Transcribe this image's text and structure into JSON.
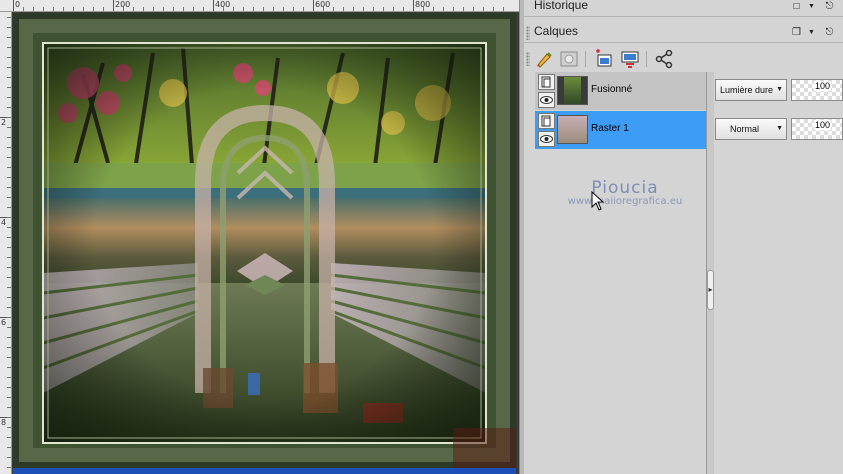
{
  "rulers": {
    "top_labels": [
      "0",
      "200",
      "400",
      "600",
      "800"
    ],
    "left_labels": [
      "2",
      "4",
      "6",
      "8"
    ]
  },
  "panels": {
    "history": {
      "title": "Historique"
    },
    "layers": {
      "title": "Calques",
      "toolbar": [
        {
          "icon": "paint-brush-icon"
        },
        {
          "icon": "mask-icon"
        },
        {
          "icon": "new-layer-icon"
        },
        {
          "icon": "layer-effects-icon"
        },
        {
          "icon": "share-icon"
        }
      ],
      "rows": [
        {
          "name": "Fusionné",
          "blend": "Lumière dure",
          "opacity": "100",
          "selected": false
        },
        {
          "name": "Raster 1",
          "blend": "Normal",
          "opacity": "100",
          "selected": true
        }
      ]
    }
  },
  "watermark": {
    "line1": "Pioucia",
    "line2": "www.maiioregrafica.eu"
  },
  "colors": {
    "selection": "#3d9cf5",
    "panel_bg": "#d4d4d4"
  }
}
